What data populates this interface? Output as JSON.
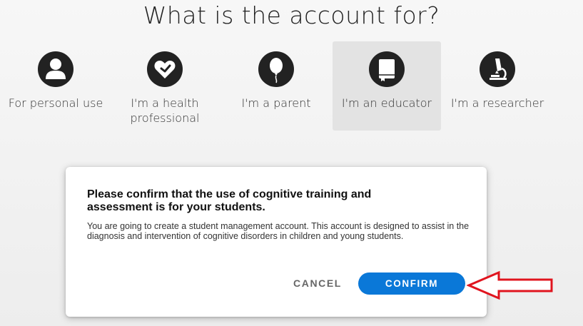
{
  "page": {
    "title": "What is the account for?"
  },
  "options": [
    {
      "label": "For personal use",
      "icon": "person-icon"
    },
    {
      "label": "I'm a health professional",
      "icon": "heart-health-icon"
    },
    {
      "label": "I'm a parent",
      "icon": "balloon-icon"
    },
    {
      "label": "I'm an educator",
      "icon": "book-icon",
      "selected": true
    },
    {
      "label": "I'm a researcher",
      "icon": "microscope-icon"
    }
  ],
  "dialog": {
    "title": "Please confirm that the use of cognitive training and assessment is for your students.",
    "body": "You are going to create a student management account. This account is designed to assist in the diagnosis and intervention of cognitive disorders in children and young students.",
    "cancel_label": "CANCEL",
    "confirm_label": "CONFIRM"
  },
  "colors": {
    "confirm_button": "#0a78d8",
    "annotation_arrow": "#e0141e",
    "icon_circle": "#222222"
  }
}
